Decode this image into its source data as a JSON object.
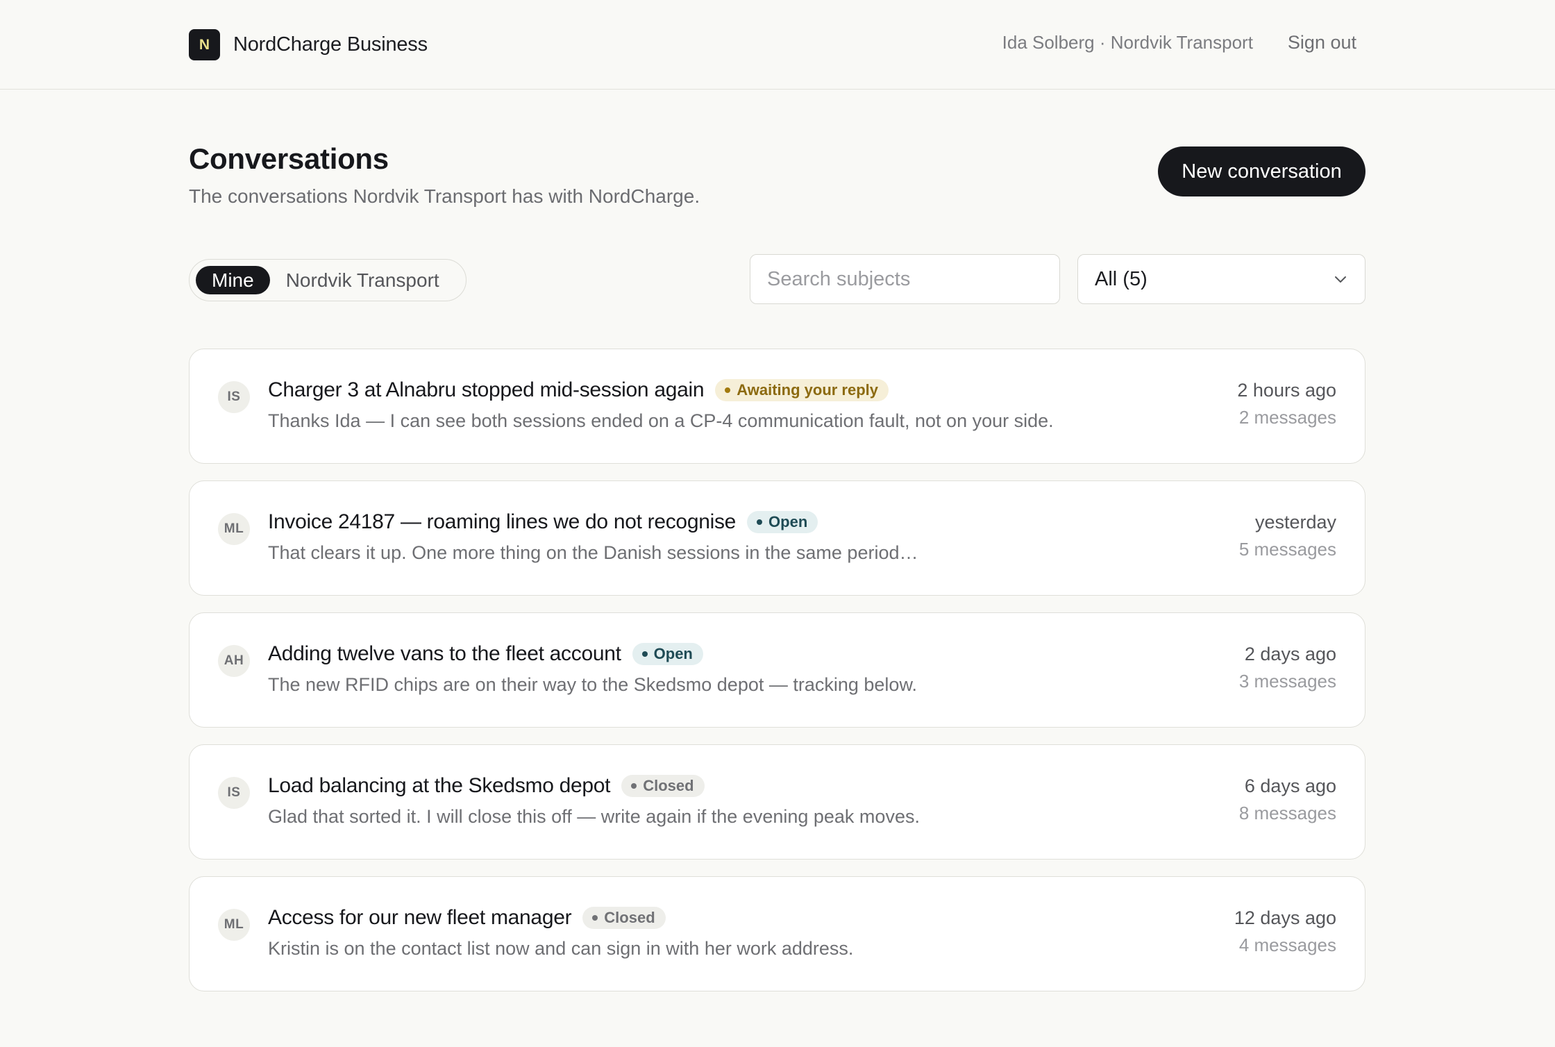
{
  "app": {
    "logo_letter": "N",
    "name": "NordCharge Business"
  },
  "user": {
    "label": "Ida Solberg · Nordvik Transport",
    "signout": "Sign out"
  },
  "header": {
    "title": "Conversations",
    "subtitle": "The conversations Nordvik Transport has with NordCharge.",
    "new_button": "New conversation"
  },
  "filters": {
    "scope_tabs": [
      {
        "label": "Mine",
        "active": true
      },
      {
        "label": "Nordvik Transport",
        "active": false
      }
    ],
    "search_placeholder": "Search subjects",
    "status_select": "All (5)"
  },
  "conversations": [
    {
      "initials": "IS",
      "subject": "Charger 3 at Alnabru stopped mid-session again",
      "status": "Awaiting your reply",
      "status_kind": "awaiting",
      "preview": "Thanks Ida — I can see both sessions ended on a CP-4 communication fault, not on your side.",
      "when": "2 hours ago",
      "count": "2 messages"
    },
    {
      "initials": "ML",
      "subject": "Invoice 24187 — roaming lines we do not recognise",
      "status": "Open",
      "status_kind": "open",
      "preview": "That clears it up. One more thing on the Danish sessions in the same period…",
      "when": "yesterday",
      "count": "5 messages"
    },
    {
      "initials": "AH",
      "subject": "Adding twelve vans to the fleet account",
      "status": "Open",
      "status_kind": "open",
      "preview": "The new RFID chips are on their way to the Skedsmo depot — tracking below.",
      "when": "2 days ago",
      "count": "3 messages"
    },
    {
      "initials": "IS",
      "subject": "Load balancing at the Skedsmo depot",
      "status": "Closed",
      "status_kind": "closed",
      "preview": "Glad that sorted it. I will close this off — write again if the evening peak moves.",
      "when": "6 days ago",
      "count": "8 messages"
    },
    {
      "initials": "ML",
      "subject": "Access for our new fleet manager",
      "status": "Closed",
      "status_kind": "closed",
      "preview": "Kristin is on the contact list now and can sign in with her work address.",
      "when": "12 days ago",
      "count": "4 messages"
    }
  ],
  "icons": {
    "select_chevron": "chevron-down-icon"
  },
  "colors": {
    "primary": "#17181c",
    "logo_letter": "#e9e08a",
    "awaiting": "#8c6a10",
    "open": "#1f4b55",
    "closed": "#707175"
  }
}
